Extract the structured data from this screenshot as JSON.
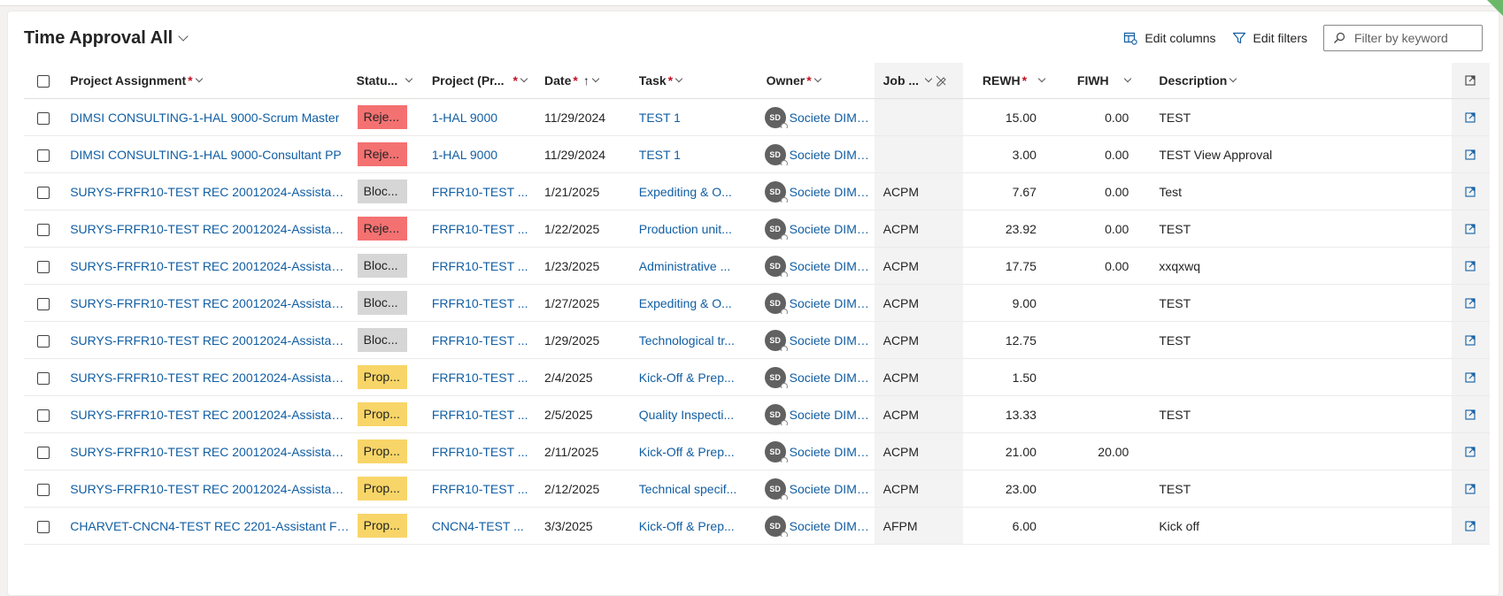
{
  "view": {
    "title": "Time Approval All",
    "edit_columns_label": "Edit columns",
    "edit_filters_label": "Edit filters",
    "search_placeholder": "Filter by keyword"
  },
  "colors": {
    "rejected": "#f47171",
    "blocked": "#d6d6d6",
    "proposed": "#f8d568",
    "link": "#115ea3",
    "required": "#c50f1f"
  },
  "columns": [
    {
      "key": "project_assignment",
      "label": "Project Assignment",
      "required": true
    },
    {
      "key": "status",
      "label": "Statu...",
      "required": false
    },
    {
      "key": "project",
      "label": "Project (Pr...",
      "required": true
    },
    {
      "key": "date",
      "label": "Date",
      "required": true,
      "sort": "↑"
    },
    {
      "key": "task",
      "label": "Task",
      "required": true
    },
    {
      "key": "owner",
      "label": "Owner",
      "required": true
    },
    {
      "key": "job",
      "label": "Job ...",
      "required": false
    },
    {
      "key": "rewh",
      "label": "REWH",
      "required": true
    },
    {
      "key": "fiwh",
      "label": "FIWH",
      "required": false
    },
    {
      "key": "description",
      "label": "Description",
      "required": false
    }
  ],
  "rows": [
    {
      "project_assignment": "DIMSI CONSULTING-1-HAL 9000-Scrum Master",
      "status": "Reje...",
      "status_kind": "rejected",
      "project": "1-HAL 9000",
      "date": "11/29/2024",
      "task": "TEST 1",
      "owner_initials": "SD",
      "owner": "Societe DIMSI (...",
      "job": "",
      "rewh": "15.00",
      "fiwh": "0.00",
      "description": "TEST"
    },
    {
      "project_assignment": "DIMSI CONSULTING-1-HAL 9000-Consultant PP",
      "status": "Reje...",
      "status_kind": "rejected",
      "project": "1-HAL 9000",
      "date": "11/29/2024",
      "task": "TEST 1",
      "owner_initials": "SD",
      "owner": "Societe DIMSI (...",
      "job": "",
      "rewh": "3.00",
      "fiwh": "0.00",
      "description": "TEST View Approval"
    },
    {
      "project_assignment": "SURYS-FRFR10-TEST REC 20012024-Assistant ...",
      "status": "Bloc...",
      "status_kind": "blocked",
      "project": "FRFR10-TEST ...",
      "date": "1/21/2025",
      "task": "Expediting & O...",
      "owner_initials": "SD",
      "owner": "Societe DIMSI (...",
      "job": "ACPM",
      "rewh": "7.67",
      "fiwh": "0.00",
      "description": "Test"
    },
    {
      "project_assignment": "SURYS-FRFR10-TEST REC 20012024-Assistant ...",
      "status": "Reje...",
      "status_kind": "rejected",
      "project": "FRFR10-TEST ...",
      "date": "1/22/2025",
      "task": "Production unit...",
      "owner_initials": "SD",
      "owner": "Societe DIMSI (...",
      "job": "ACPM",
      "rewh": "23.92",
      "fiwh": "0.00",
      "description": "TEST"
    },
    {
      "project_assignment": "SURYS-FRFR10-TEST REC 20012024-Assistant ...",
      "status": "Bloc...",
      "status_kind": "blocked",
      "project": "FRFR10-TEST ...",
      "date": "1/23/2025",
      "task": "Administrative ...",
      "owner_initials": "SD",
      "owner": "Societe DIMSI (...",
      "job": "ACPM",
      "rewh": "17.75",
      "fiwh": "0.00",
      "description": "xxqxwq"
    },
    {
      "project_assignment": "SURYS-FRFR10-TEST REC 20012024-Assistant ...",
      "status": "Bloc...",
      "status_kind": "blocked",
      "project": "FRFR10-TEST ...",
      "date": "1/27/2025",
      "task": "Expediting & O...",
      "owner_initials": "SD",
      "owner": "Societe DIMSI (...",
      "job": "ACPM",
      "rewh": "9.00",
      "fiwh": "",
      "description": "TEST"
    },
    {
      "project_assignment": "SURYS-FRFR10-TEST REC 20012024-Assistant ...",
      "status": "Bloc...",
      "status_kind": "blocked",
      "project": "FRFR10-TEST ...",
      "date": "1/29/2025",
      "task": "Technological tr...",
      "owner_initials": "SD",
      "owner": "Societe DIMSI (...",
      "job": "ACPM",
      "rewh": "12.75",
      "fiwh": "",
      "description": "TEST"
    },
    {
      "project_assignment": "SURYS-FRFR10-TEST REC 20012024-Assistant ...",
      "status": "Prop...",
      "status_kind": "proposed",
      "project": "FRFR10-TEST ...",
      "date": "2/4/2025",
      "task": "Kick-Off & Prep...",
      "owner_initials": "SD",
      "owner": "Societe DIMSI (...",
      "job": "ACPM",
      "rewh": "1.50",
      "fiwh": "",
      "description": ""
    },
    {
      "project_assignment": "SURYS-FRFR10-TEST REC 20012024-Assistant ...",
      "status": "Prop...",
      "status_kind": "proposed",
      "project": "FRFR10-TEST ...",
      "date": "2/5/2025",
      "task": "Quality Inspecti...",
      "owner_initials": "SD",
      "owner": "Societe DIMSI (...",
      "job": "ACPM",
      "rewh": "13.33",
      "fiwh": "",
      "description": "TEST"
    },
    {
      "project_assignment": "SURYS-FRFR10-TEST REC 20012024-Assistant ...",
      "status": "Prop...",
      "status_kind": "proposed",
      "project": "FRFR10-TEST ...",
      "date": "2/11/2025",
      "task": "Kick-Off & Prep...",
      "owner_initials": "SD",
      "owner": "Societe DIMSI (...",
      "job": "ACPM",
      "rewh": "21.00",
      "fiwh": "20.00",
      "description": ""
    },
    {
      "project_assignment": "SURYS-FRFR10-TEST REC 20012024-Assistant ...",
      "status": "Prop...",
      "status_kind": "proposed",
      "project": "FRFR10-TEST ...",
      "date": "2/12/2025",
      "task": "Technical specif...",
      "owner_initials": "SD",
      "owner": "Societe DIMSI (...",
      "job": "ACPM",
      "rewh": "23.00",
      "fiwh": "",
      "description": "TEST"
    },
    {
      "project_assignment": "CHARVET-CNCN4-TEST REC 2201-Assistant Fr...",
      "status": "Prop...",
      "status_kind": "proposed",
      "project": "CNCN4-TEST ...",
      "date": "3/3/2025",
      "task": "Kick-Off & Prep...",
      "owner_initials": "SD",
      "owner": "Societe DIMSI (...",
      "job": "AFPM",
      "rewh": "6.00",
      "fiwh": "",
      "description": "Kick off"
    }
  ]
}
